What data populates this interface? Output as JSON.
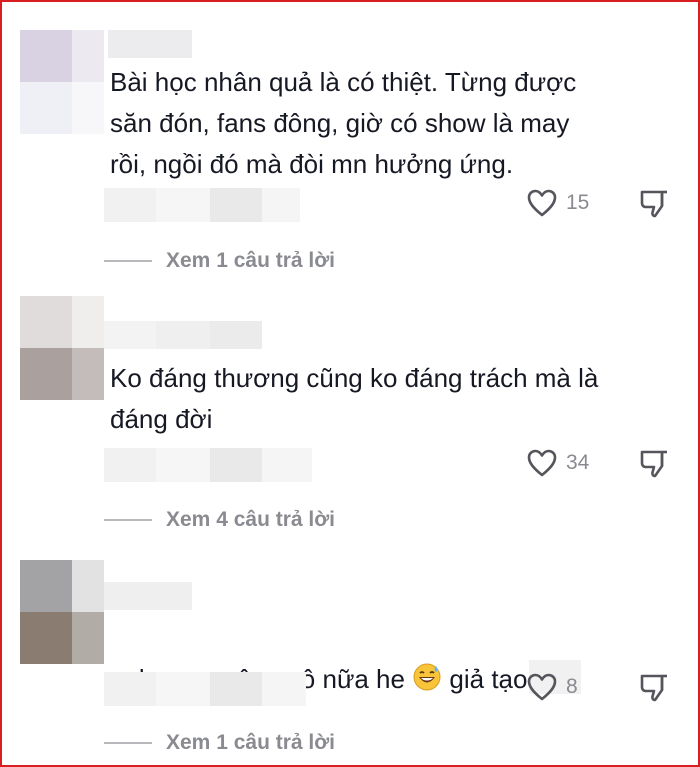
{
  "comments": [
    {
      "text": "Bài học nhân quả là có thiệt. Từng được\nsăn đón, fans đông, giờ có show là may\nrồi, ngồi đó mà đòi mn hưởng ứng.",
      "likes": "15",
      "replies_label": "Xem 1 câu trả lời"
    },
    {
      "text": "Ko đáng thương cũng ko đáng trách mà là\nđáng đời",
      "likes": "34",
      "replies_label": "Xem 4 câu trả lời"
    },
    {
      "text_before_emoji": "ko nc ngây ngô nữa he ",
      "emoji": "grinning-sweat-emoji",
      "text_after_emoji": " giả tạo",
      "likes": "8",
      "replies_label": "Xem 1 câu trả lời"
    }
  ],
  "colors": {
    "frame_border": "#d81e1e",
    "text": "#161823",
    "muted": "#8a8b91",
    "icon": "#55565c"
  }
}
